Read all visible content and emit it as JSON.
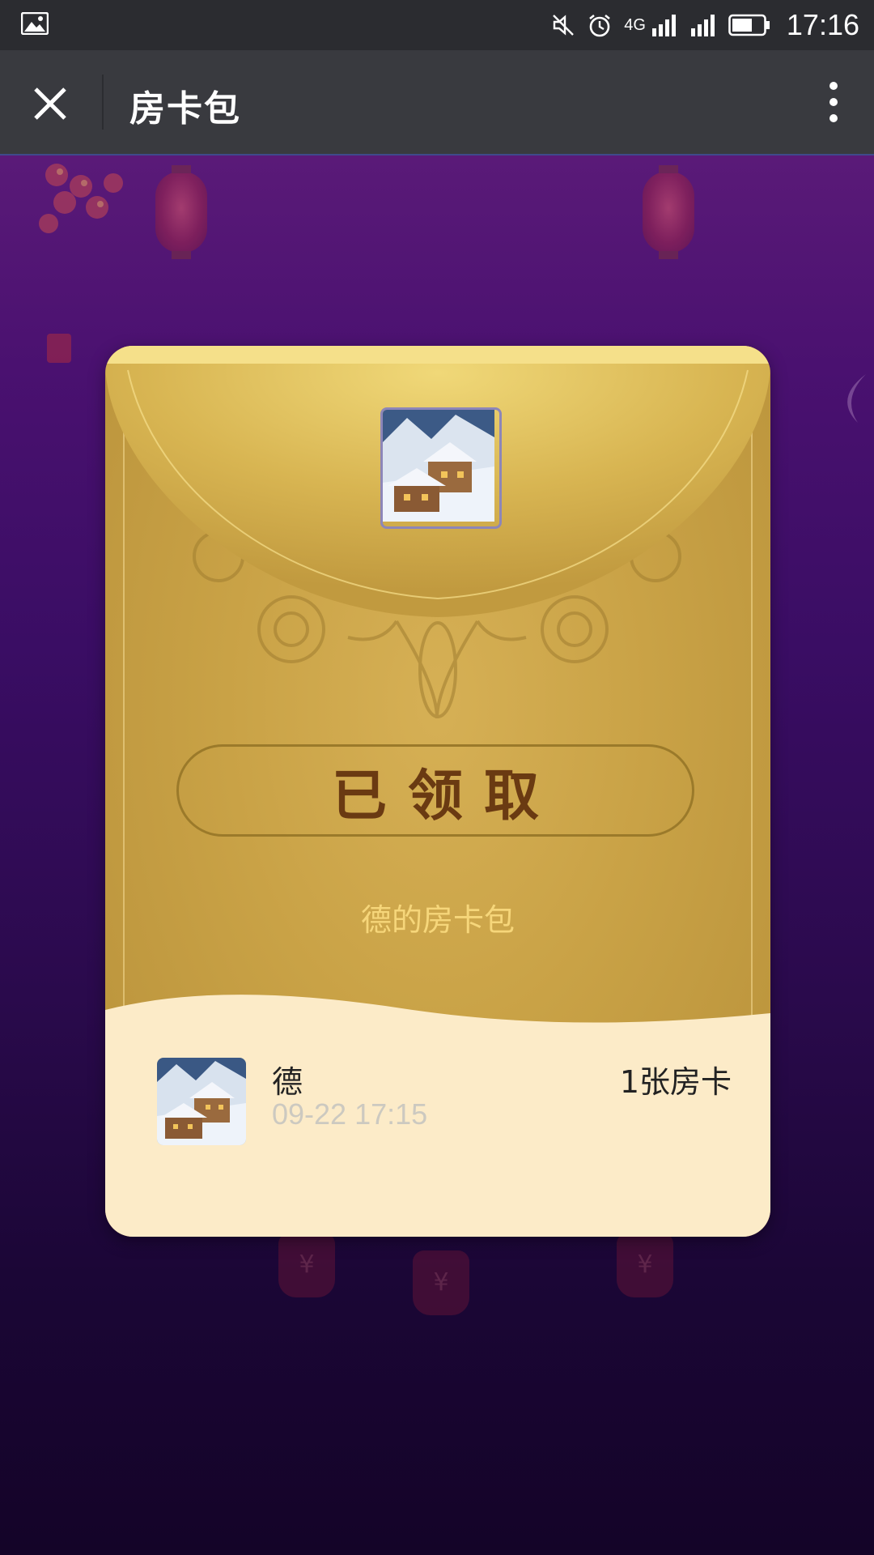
{
  "status_bar": {
    "time": "17:16",
    "network": "4G",
    "icons": [
      "gallery-icon",
      "mute-icon",
      "alarm-icon",
      "signal-icon",
      "signal-icon",
      "battery-icon"
    ]
  },
  "nav": {
    "title": "房卡包",
    "close_icon": "close-icon",
    "more_icon": "more-vertical-icon"
  },
  "envelope": {
    "claim_label": "已领取",
    "owner_text": "德的房卡包"
  },
  "records": [
    {
      "name": "德",
      "time": "09-22 17:15",
      "count": "1张房卡"
    }
  ],
  "colors": {
    "gold": "#c9a246",
    "cream": "#fdeac8",
    "owner_text": "#f6d67a",
    "claim_text": "#6a3a12"
  }
}
